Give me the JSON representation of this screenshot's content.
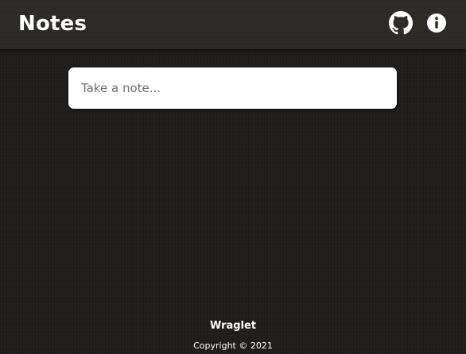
{
  "header": {
    "title": "Notes",
    "icons": {
      "github": "github-icon",
      "info": "info-icon"
    }
  },
  "note_input": {
    "placeholder": "Take a note...",
    "value": ""
  },
  "footer": {
    "brand": "Wraglet",
    "copyright": "Copyright © 2021"
  },
  "colors": {
    "page_background": "#1f1e1c",
    "header_background": "#2b2a27",
    "text": "#ffffff",
    "input_background": "#ffffff",
    "placeholder": "#6e6e6e"
  }
}
